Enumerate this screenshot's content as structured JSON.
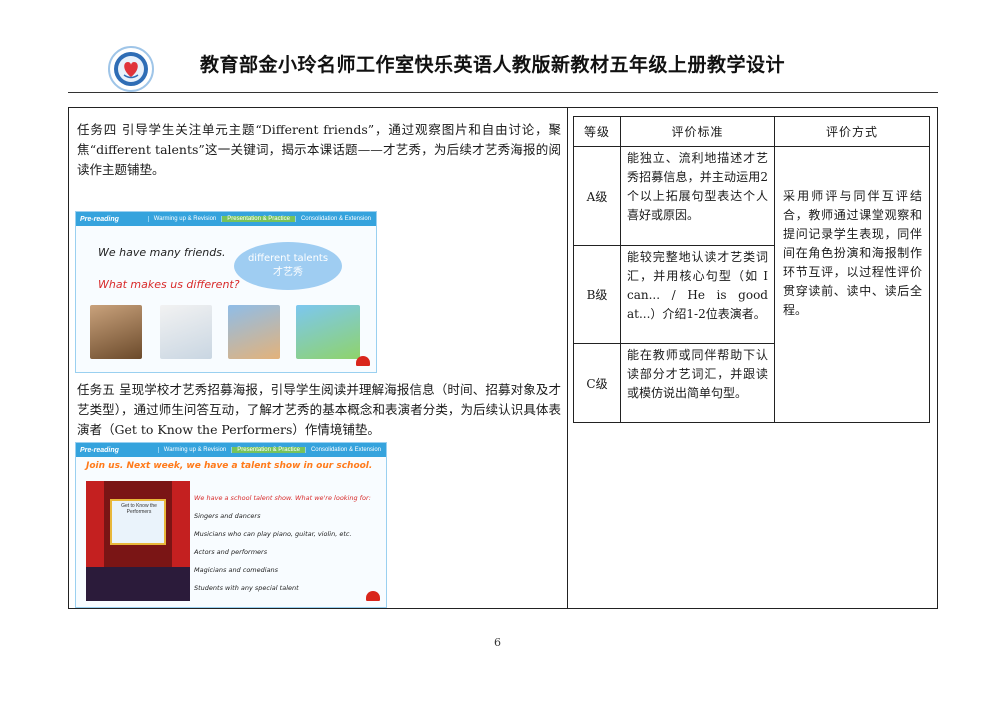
{
  "header": {
    "title": "教育部金小玲名师工作室快乐英语人教版新教材五年级上册教学设计",
    "logo_icon": "studio-seal-logo"
  },
  "task4": {
    "text": "任务四 引导学生关注单元主题“Different friends”，通过观察图片和自由讨论，聚焦“different talents”这一关键词，揭示本课话题——才艺秀，为后续才艺秀海报的阅读作主题铺垫。",
    "slide": {
      "nav": [
        "Pre-reading",
        "Warming up & Revision",
        "Presentation & Practice",
        "Consolidation & Extension"
      ],
      "line1": "We have many friends.",
      "line2": "What makes us different?",
      "cloud_en": "different talents",
      "cloud_cn": "才艺秀"
    }
  },
  "task5": {
    "text": "任务五 呈现学校才艺秀招募海报，引导学生阅读并理解海报信息（时间、招募对象及才艺类型），通过师生问答互动，了解才艺秀的基本概念和表演者分类，为后续认识具体表演者（Get to Know the Performers）作情境铺垫。",
    "slide": {
      "nav": [
        "Pre-reading",
        "Warming up & Revision",
        "Presentation & Practice",
        "Consolidation & Extension"
      ],
      "header": "Join us. Next week, we have a talent show in our school.",
      "screen_title": "Get to Know the Performers",
      "lead": "We have a school talent show. What we're looking for:",
      "items": [
        "Singers and dancers",
        "Musicians who can play piano, guitar, violin, etc.",
        "Actors and performers",
        "Magicians and comedians",
        "Students with any special talent"
      ]
    }
  },
  "rubric": {
    "headers": [
      "等级",
      "评价标准",
      "评价方式"
    ],
    "rows": [
      {
        "grade": "A级",
        "criteria": "能独立、流利地描述才艺秀招募信息，并主动运用2个以上拓展句型表达个人喜好或原因。"
      },
      {
        "grade": "B级",
        "criteria": "能较完整地认读才艺类词汇，并用核心句型（如 I can... / He is good at...）介绍1-2位表演者。"
      },
      {
        "grade": "C级",
        "criteria": "能在教师或同伴帮助下认读部分才艺词汇，并跟读或模仿说出简单句型。"
      }
    ],
    "method": "采用师评与同伴互评结合，教师通过课堂观察和提问记录学生表现，同伴间在角色扮演和海报制作环节互评，以过程性评价贯穿读前、读中、读后全程。"
  },
  "footer": {
    "page_number": "6"
  },
  "colors": {
    "nav_blue": "#35a3dd",
    "nav_active_green": "#77c35a",
    "accent_red": "#d82b2b",
    "header_orange": "#ff7a1a"
  }
}
